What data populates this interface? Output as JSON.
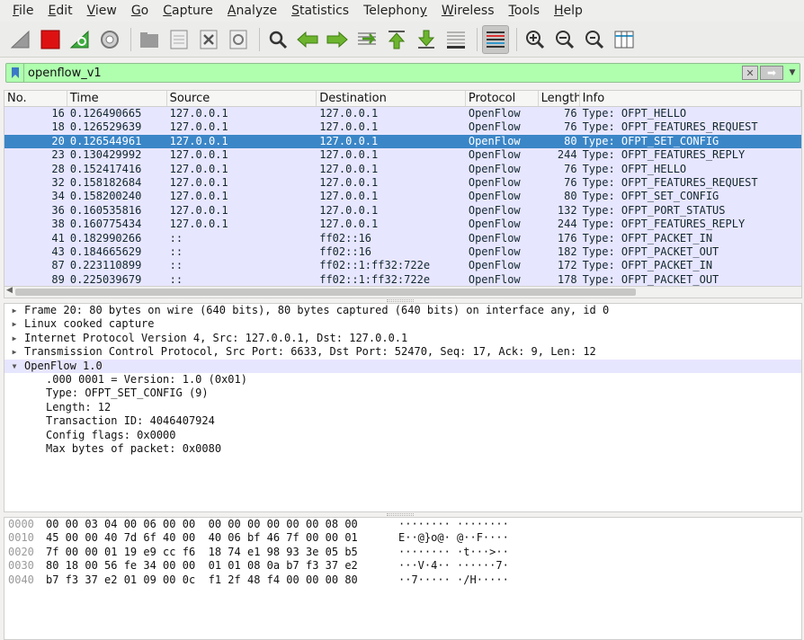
{
  "menu": [
    "File",
    "Edit",
    "View",
    "Go",
    "Capture",
    "Analyze",
    "Statistics",
    "Telephony",
    "Wireless",
    "Tools",
    "Help"
  ],
  "menu_underline_index": [
    0,
    0,
    0,
    0,
    0,
    0,
    0,
    8,
    0,
    0,
    0
  ],
  "toolbar": {
    "icons": [
      "shark-fin-start-icon",
      "stop-capture-icon",
      "restart-capture-icon",
      "capture-options-icon",
      "open-file-icon",
      "save-file-icon",
      "close-file-icon",
      "reload-file-icon",
      "find-packet-icon",
      "go-back-icon",
      "go-forward-icon",
      "go-to-packet-icon",
      "go-first-icon",
      "go-last-icon",
      "autoscroll-icon",
      "colorize-icon",
      "zoom-in-icon",
      "zoom-out-icon",
      "zoom-normal-icon",
      "resize-columns-icon"
    ]
  },
  "filter": {
    "value": "openflow_v1",
    "color": "#afffaf"
  },
  "packet_list": {
    "columns": [
      "No.",
      "Time",
      "Source",
      "Destination",
      "Protocol",
      "Length",
      "Info"
    ],
    "rows": [
      {
        "no": "16",
        "time": "0.126490665",
        "src": "127.0.0.1",
        "dst": "127.0.0.1",
        "proto": "OpenFlow",
        "len": "76",
        "info": "Type: OFPT_HELLO"
      },
      {
        "no": "18",
        "time": "0.126529639",
        "src": "127.0.0.1",
        "dst": "127.0.0.1",
        "proto": "OpenFlow",
        "len": "76",
        "info": "Type: OFPT_FEATURES_REQUEST"
      },
      {
        "no": "20",
        "time": "0.126544961",
        "src": "127.0.0.1",
        "dst": "127.0.0.1",
        "proto": "OpenFlow",
        "len": "80",
        "info": "Type: OFPT_SET_CONFIG",
        "selected": true
      },
      {
        "no": "23",
        "time": "0.130429992",
        "src": "127.0.0.1",
        "dst": "127.0.0.1",
        "proto": "OpenFlow",
        "len": "244",
        "info": "Type: OFPT_FEATURES_REPLY"
      },
      {
        "no": "28",
        "time": "0.152417416",
        "src": "127.0.0.1",
        "dst": "127.0.0.1",
        "proto": "OpenFlow",
        "len": "76",
        "info": "Type: OFPT_HELLO"
      },
      {
        "no": "32",
        "time": "0.158182684",
        "src": "127.0.0.1",
        "dst": "127.0.0.1",
        "proto": "OpenFlow",
        "len": "76",
        "info": "Type: OFPT_FEATURES_REQUEST"
      },
      {
        "no": "34",
        "time": "0.158200240",
        "src": "127.0.0.1",
        "dst": "127.0.0.1",
        "proto": "OpenFlow",
        "len": "80",
        "info": "Type: OFPT_SET_CONFIG"
      },
      {
        "no": "36",
        "time": "0.160535816",
        "src": "127.0.0.1",
        "dst": "127.0.0.1",
        "proto": "OpenFlow",
        "len": "132",
        "info": "Type: OFPT_PORT_STATUS"
      },
      {
        "no": "38",
        "time": "0.160775434",
        "src": "127.0.0.1",
        "dst": "127.0.0.1",
        "proto": "OpenFlow",
        "len": "244",
        "info": "Type: OFPT_FEATURES_REPLY"
      },
      {
        "no": "41",
        "time": "0.182990266",
        "src": "::",
        "dst": "ff02::16",
        "proto": "OpenFlow",
        "len": "176",
        "info": "Type: OFPT_PACKET_IN"
      },
      {
        "no": "43",
        "time": "0.184665629",
        "src": "::",
        "dst": "ff02::16",
        "proto": "OpenFlow",
        "len": "182",
        "info": "Type: OFPT_PACKET_OUT"
      },
      {
        "no": "87",
        "time": "0.223110899",
        "src": "::",
        "dst": "ff02::1:ff32:722e",
        "proto": "OpenFlow",
        "len": "172",
        "info": "Type: OFPT_PACKET_IN"
      },
      {
        "no": "89",
        "time": "0.225039679",
        "src": "::",
        "dst": "ff02::1:ff32:722e",
        "proto": "OpenFlow",
        "len": "178",
        "info": "Type: OFPT_PACKET_OUT"
      }
    ],
    "row_color": "#e7e6ff",
    "selected_color": "#3b86c7"
  },
  "details": {
    "tree": [
      {
        "text": "Frame 20: 80 bytes on wire (640 bits), 80 bytes captured (640 bits) on interface any, id 0",
        "expanded": false
      },
      {
        "text": "Linux cooked capture",
        "expanded": false
      },
      {
        "text": "Internet Protocol Version 4, Src: 127.0.0.1, Dst: 127.0.0.1",
        "expanded": false
      },
      {
        "text": "Transmission Control Protocol, Src Port: 6633, Dst Port: 52470, Seq: 17, Ack: 9, Len: 12",
        "expanded": false
      },
      {
        "text": "OpenFlow 1.0",
        "expanded": true
      }
    ],
    "children": [
      ".000 0001 = Version: 1.0 (0x01)",
      "Type: OFPT_SET_CONFIG (9)",
      "Length: 12",
      "Transaction ID: 4046407924",
      "Config flags: 0x0000",
      "Max bytes of packet: 0x0080"
    ]
  },
  "bytes": [
    {
      "off": "0000",
      "hex": "00 00 03 04 00 06 00 00  00 00 00 00 00 00 08 00",
      "ascii": "········ ········"
    },
    {
      "off": "0010",
      "hex": "45 00 00 40 7d 6f 40 00  40 06 bf 46 7f 00 00 01",
      "ascii": "E··@}o@· @··F····"
    },
    {
      "off": "0020",
      "hex": "7f 00 00 01 19 e9 cc f6  18 74 e1 98 93 3e 05 b5",
      "ascii": "········ ·t···>··"
    },
    {
      "off": "0030",
      "hex": "80 18 00 56 fe 34 00 00  01 01 08 0a b7 f3 37 e2",
      "ascii": "···V·4·· ······7·"
    },
    {
      "off": "0040",
      "hex": "b7 f3 37 e2 01 09 00 0c  f1 2f 48 f4 00 00 00 80",
      "ascii": "··7····· ·/H·····"
    }
  ]
}
